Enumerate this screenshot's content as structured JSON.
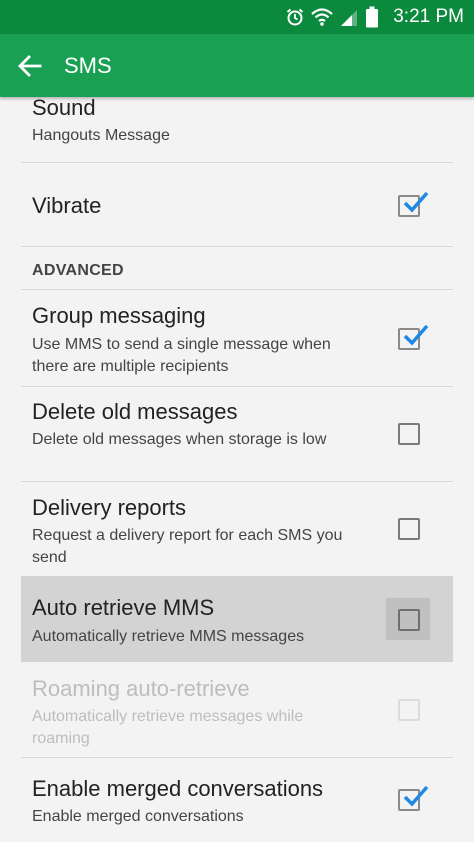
{
  "status": {
    "time": "3:21 PM"
  },
  "appbar": {
    "title": "SMS"
  },
  "items": {
    "sound": {
      "title": "Sound",
      "summary": "Hangouts Message"
    },
    "vibrate": {
      "title": "Vibrate",
      "checked": true
    },
    "section_advanced": "ADVANCED",
    "group_messaging": {
      "title": "Group messaging",
      "summary": "Use MMS to send a single message when there are multiple recipients",
      "checked": true
    },
    "delete_old": {
      "title": "Delete old messages",
      "summary": "Delete old messages when storage is low",
      "checked": false
    },
    "delivery_reports": {
      "title": "Delivery reports",
      "summary": "Request a delivery report for each SMS you send",
      "checked": false
    },
    "auto_retrieve": {
      "title": "Auto retrieve MMS",
      "summary": "Automatically retrieve MMS messages",
      "checked": false
    },
    "roaming": {
      "title": "Roaming auto-retrieve",
      "summary": "Automatically retrieve messages while roaming",
      "checked": false,
      "disabled": true
    },
    "merged": {
      "title": "Enable merged conversations",
      "summary": "Enable merged conversations",
      "checked": true
    }
  },
  "colors": {
    "statusbar": "#0b8a3d",
    "appbar": "#1aa052",
    "check": "#1e88e5"
  },
  "icons": [
    "alarm-icon",
    "wifi-icon",
    "signal-icon",
    "battery-icon",
    "back-arrow-icon",
    "check-icon"
  ]
}
